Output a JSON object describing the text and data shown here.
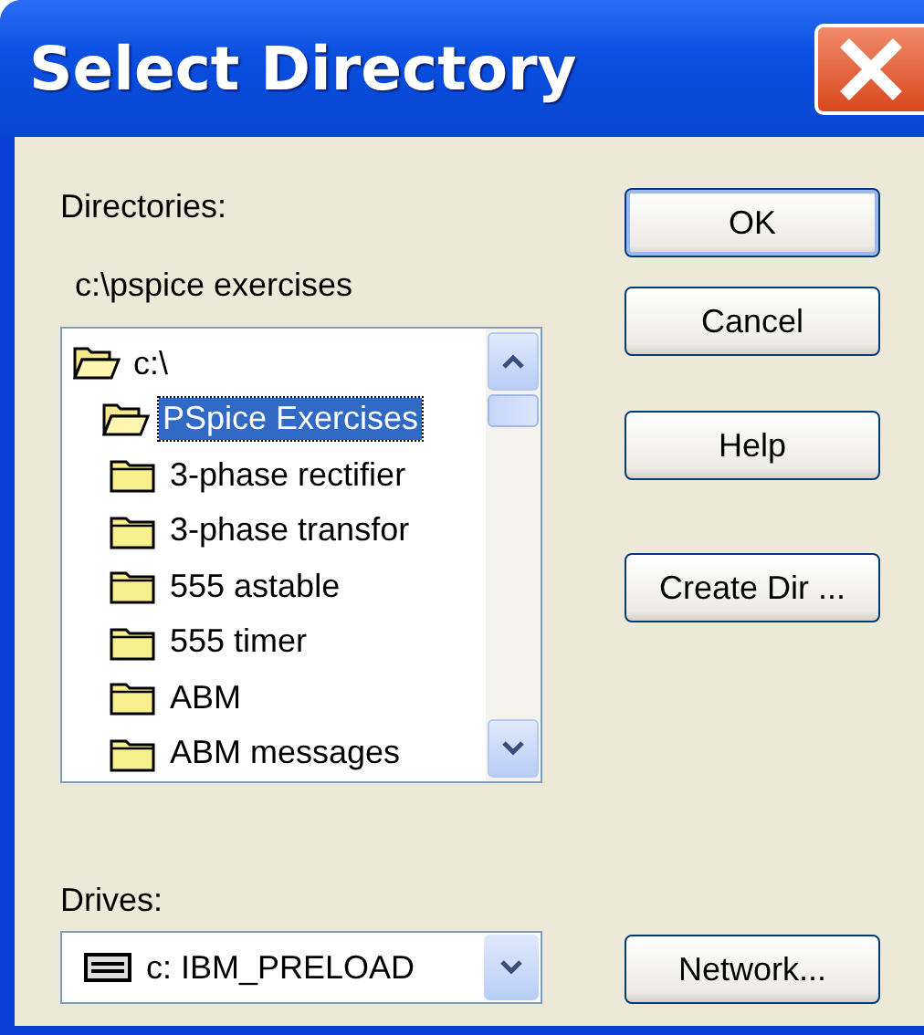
{
  "window": {
    "title": "Select Directory"
  },
  "directories": {
    "label": "Directories:",
    "path": "c:\\pspice exercises",
    "tree": [
      {
        "label": "c:\\",
        "expanded": true,
        "selected": false,
        "children": [
          {
            "label": "PSpice Exercises",
            "expanded": true,
            "selected": true,
            "children": [
              {
                "label": "3-phase rectifier",
                "expanded": false,
                "selected": false
              },
              {
                "label": "3-phase transfor",
                "expanded": false,
                "selected": false
              },
              {
                "label": "555 astable",
                "expanded": false,
                "selected": false
              },
              {
                "label": "555 timer",
                "expanded": false,
                "selected": false
              },
              {
                "label": "ABM",
                "expanded": false,
                "selected": false
              },
              {
                "label": "ABM messages",
                "expanded": false,
                "selected": false
              }
            ]
          }
        ]
      }
    ]
  },
  "drives": {
    "label": "Drives:",
    "value": "c: IBM_PRELOAD"
  },
  "buttons": [
    {
      "label": "OK",
      "kind": "default"
    },
    {
      "label": "Cancel",
      "kind": "normal"
    },
    {
      "label": "Help",
      "kind": "normal"
    },
    {
      "label": "Create Dir ...",
      "kind": "normal"
    }
  ],
  "network_button": {
    "label": "Network..."
  }
}
